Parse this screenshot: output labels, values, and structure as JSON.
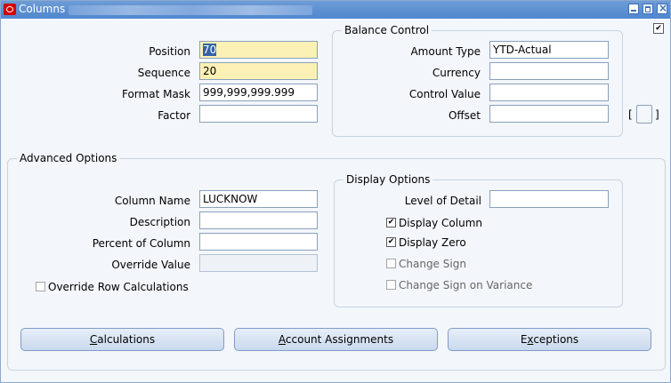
{
  "window": {
    "title": "Columns",
    "icon": "oracle-logo-icon"
  },
  "main": {
    "position_label": "Position",
    "position_value": "70",
    "sequence_label": "Sequence",
    "sequence_value": "20",
    "format_mask_label": "Format Mask",
    "format_mask_value": "999,999,999.999",
    "factor_label": "Factor",
    "factor_value": ""
  },
  "balance_control": {
    "title": "Balance Control",
    "amount_type_label": "Amount Type",
    "amount_type_value": "YTD-Actual",
    "currency_label": "Currency",
    "currency_value": "",
    "control_value_label": "Control Value",
    "control_value_value": "",
    "offset_label": "Offset",
    "offset_value": ""
  },
  "advanced": {
    "title": "Advanced Options",
    "column_name_label": "Column Name",
    "column_name_value": "LUCKNOW",
    "description_label": "Description",
    "description_value": "",
    "percent_label": "Percent of Column",
    "percent_value": "",
    "override_value_label": "Override Value",
    "override_value_value": "",
    "override_row_calc_label": "Override Row Calculations",
    "override_row_calc_checked": false
  },
  "display": {
    "title": "Display Options",
    "level_of_detail_label": "Level of Detail",
    "level_of_detail_value": "",
    "display_column_label": "Display Column",
    "display_column_checked": true,
    "display_zero_label": "Display Zero",
    "display_zero_checked": true,
    "change_sign_label": "Change Sign",
    "change_sign_checked": false,
    "change_sign_variance_label": "Change Sign on Variance",
    "change_sign_variance_checked": false
  },
  "buttons": {
    "calculations_accel": "C",
    "calculations_rest": "alculations",
    "account_assignments_accel": "A",
    "account_assignments_rest": "ccount Assignments",
    "exceptions_prefix": "E",
    "exceptions_accel": "x",
    "exceptions_rest": "ceptions"
  },
  "misc": {
    "bracket_left": "[",
    "bracket_right": "]",
    "check_glyph": "✔"
  }
}
